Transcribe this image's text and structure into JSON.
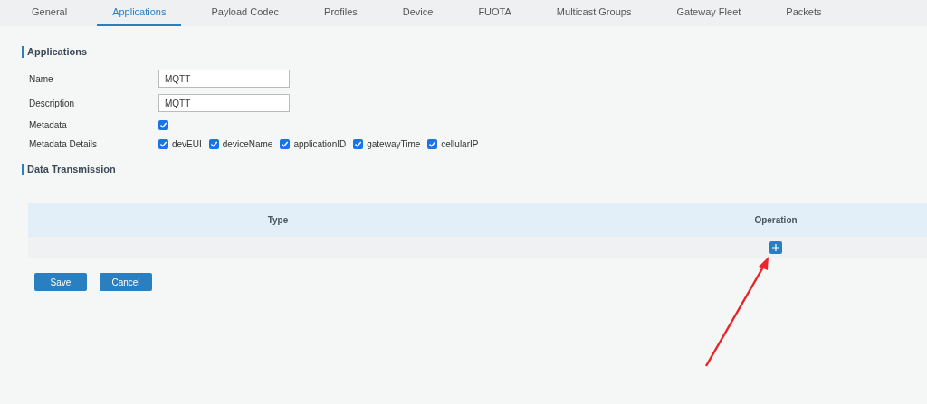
{
  "tabs": [
    {
      "label": "General",
      "selected": false
    },
    {
      "label": "Applications",
      "selected": true
    },
    {
      "label": "Payload Codec",
      "selected": false
    },
    {
      "label": "Profiles",
      "selected": false
    },
    {
      "label": "Device",
      "selected": false
    },
    {
      "label": "FUOTA",
      "selected": false
    },
    {
      "label": "Multicast Groups",
      "selected": false
    },
    {
      "label": "Gateway Fleet",
      "selected": false
    },
    {
      "label": "Packets",
      "selected": false
    }
  ],
  "applications": {
    "heading": "Applications",
    "name": {
      "label": "Name",
      "value": "MQTT"
    },
    "description": {
      "label": "Description",
      "value": "MQTT"
    },
    "metadata": {
      "label": "Metadata",
      "checked": true
    },
    "metadata_details": {
      "label": "Metadata Details",
      "options": [
        {
          "label": "devEUI",
          "checked": true
        },
        {
          "label": "deviceName",
          "checked": true
        },
        {
          "label": "applicationID",
          "checked": true
        },
        {
          "label": "gatewayTime",
          "checked": true
        },
        {
          "label": "cellularIP",
          "checked": true
        }
      ]
    }
  },
  "data_transmission": {
    "heading": "Data Transmission",
    "table": {
      "columns": [
        "Type",
        "Operation"
      ]
    }
  },
  "buttons": [
    "Save",
    "Cancel"
  ]
}
